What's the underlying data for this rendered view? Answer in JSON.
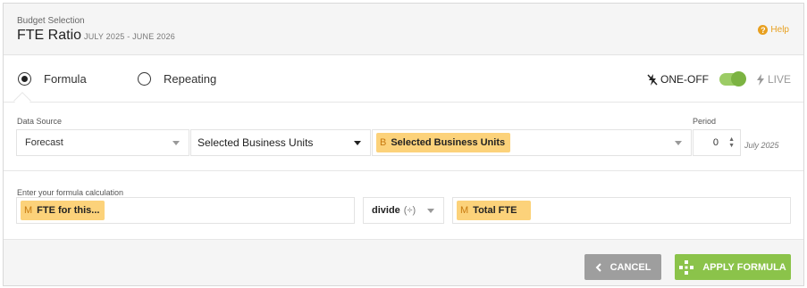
{
  "header": {
    "section_label": "Budget Selection",
    "title": "FTE Ratio",
    "period": "JULY 2025 - JUNE 2026",
    "help_label": "Help"
  },
  "mode": {
    "formula_label": "Formula",
    "repeating_label": "Repeating",
    "selected": "Formula",
    "oneoff_label": "ONE-OFF",
    "live_label": "LIVE",
    "toggle_state": "one-off"
  },
  "data_source": {
    "label": "Data Source",
    "source_value": "Forecast",
    "business_units_value": "Selected Business Units",
    "tag_letter": "B",
    "tag_label": "Selected Business Units",
    "period_label": "Period",
    "period_value": "0",
    "period_date": "July 2025"
  },
  "formula": {
    "label": "Enter your formula calculation",
    "left_tag_letter": "M",
    "left_tag_label": "FTE for this...",
    "operator": "divide",
    "operator_symbol": "(÷)",
    "right_tag_letter": "M",
    "right_tag_label": "Total FTE"
  },
  "footer": {
    "cancel_label": "CANCEL",
    "apply_label": "APPLY FORMULA"
  },
  "colors": {
    "accent_green": "#8bc34a",
    "tag_yellow": "#fcd27a",
    "help_orange": "#e8a020",
    "cancel_grey": "#9e9e9e"
  }
}
